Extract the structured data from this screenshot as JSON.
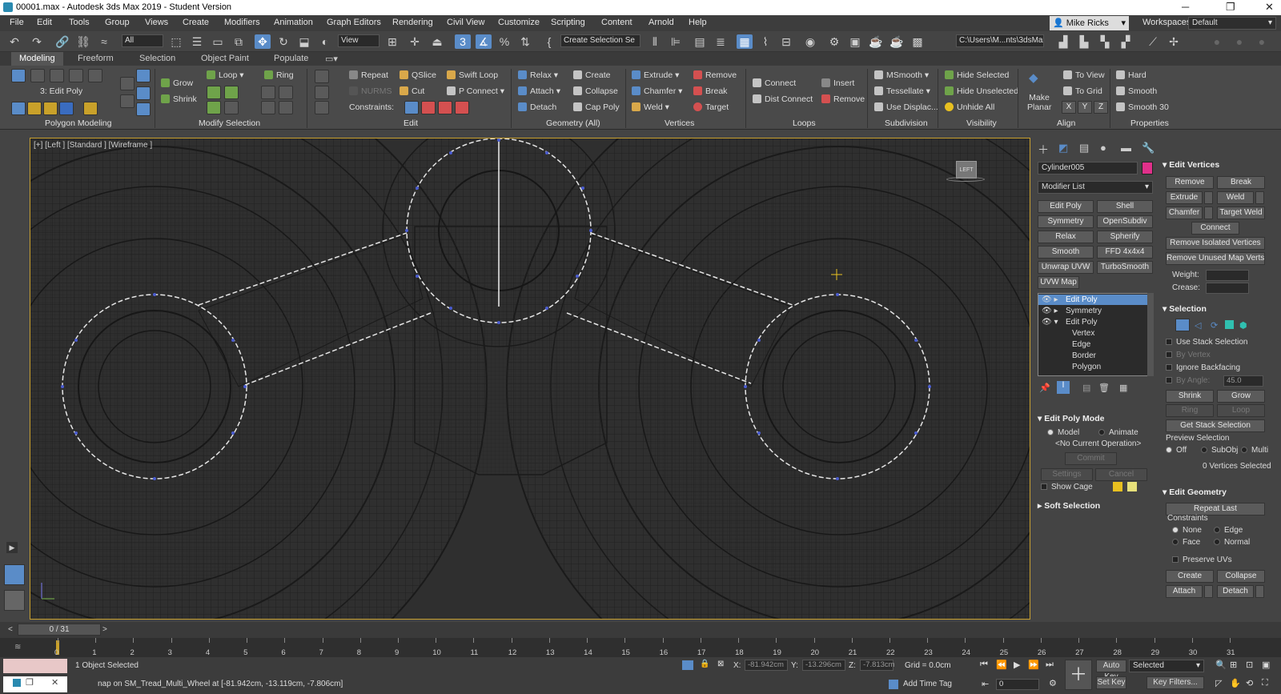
{
  "window": {
    "title": "00001.max - Autodesk 3ds Max 2019 - Student Version"
  },
  "menu": [
    "File",
    "Edit",
    "Tools",
    "Group",
    "Views",
    "Create",
    "Modifiers",
    "Animation",
    "Graph Editors",
    "Rendering",
    "Civil View",
    "Customize",
    "Scripting",
    "Content",
    "Arnold",
    "Help"
  ],
  "user": {
    "name": "Mike Ricks",
    "workspaces_label": "Workspaces:",
    "workspace": "Default"
  },
  "toolbar": {
    "filter": "All",
    "refcoord": "View",
    "selset": "Create Selection Se",
    "path": "C:\\Users\\M...nts\\3dsMax"
  },
  "ribbon_tabs": [
    "Modeling",
    "Freeform",
    "Selection",
    "Object Paint",
    "Populate"
  ],
  "ribbon": {
    "stack_label": "3: Edit Poly",
    "grow": "Grow",
    "shrink": "Shrink",
    "loop": "Loop",
    "ring": "Ring",
    "repeat": "Repeat",
    "nurms": "NURMS",
    "constraints": "Constraints:",
    "qslice": "QSlice",
    "cut": "Cut",
    "swift_loop": "Swift Loop",
    "p_connect": "P Connect",
    "relax": "Relax",
    "attach": "Attach",
    "detach": "Detach",
    "create": "Create",
    "collapse": "Collapse",
    "cap_poly": "Cap Poly",
    "extrude": "Extrude",
    "chamfer": "Chamfer",
    "weld": "Weld",
    "remove": "Remove",
    "break": "Break",
    "target": "Target",
    "connect": "Connect",
    "dist_connect": "Dist Connect",
    "insert": "Insert",
    "remove2": "Remove",
    "msmooth": "MSmooth",
    "tessellate": "Tessellate",
    "use_displac": "Use Displac...",
    "hide_selected": "Hide Selected",
    "hide_unselected": "Hide Unselected",
    "unhide_all": "Unhide All",
    "make_planar": "Make Planar",
    "to_view": "To View",
    "to_grid": "To Grid",
    "x": "X",
    "y": "Y",
    "z": "Z",
    "hard": "Hard",
    "smooth": "Smooth",
    "smooth30": "Smooth 30",
    "panels": [
      "Polygon Modeling",
      "Modify Selection",
      "Edit",
      "Geometry (All)",
      "Vertices",
      "Loops",
      "Subdivision",
      "Visibility",
      "Align",
      "Properties"
    ]
  },
  "viewport": {
    "label": "[+] [Left ] [Standard ] [Wireframe ]",
    "cube_label": "LEFT"
  },
  "cmd": {
    "object_name": "Cylinder005",
    "modifier_list": "Modifier List",
    "mod_buttons": [
      "Edit Poly",
      "Shell",
      "Symmetry",
      "OpenSubdiv",
      "Relax",
      "Spherify",
      "Smooth",
      "FFD 4x4x4",
      "Unwrap UVW",
      "TurboSmooth",
      "UVW Map"
    ],
    "stack": [
      "Edit Poly",
      "Symmetry",
      "Edit Poly",
      "Vertex",
      "Edge",
      "Border",
      "Polygon"
    ],
    "edit_poly_mode": "Edit Poly Mode",
    "model": "Model",
    "animate": "Animate",
    "no_op": "<No Current Operation>",
    "commit": "Commit",
    "settings": "Settings",
    "cancel": "Cancel",
    "show_cage": "Show Cage",
    "soft_selection": "Soft Selection",
    "edit_vertices": "Edit Vertices",
    "remove": "Remove",
    "break": "Break",
    "extrude": "Extrude",
    "weld": "Weld",
    "chamfer": "Chamfer",
    "target_weld": "Target Weld",
    "connect": "Connect",
    "remove_isolated": "Remove Isolated Vertices",
    "remove_unused": "Remove Unused Map Verts",
    "weight": "Weight:",
    "crease": "Crease:",
    "selection": "Selection",
    "use_stack": "Use Stack Selection",
    "by_vertex": "By Vertex",
    "ignore_backfacing": "Ignore Backfacing",
    "by_angle": "By Angle:",
    "angle_val": "45.0",
    "shrink": "Shrink",
    "grow": "Grow",
    "ring": "Ring",
    "loop": "Loop",
    "get_stack": "Get Stack Selection",
    "preview_selection": "Preview Selection",
    "off": "Off",
    "subobj": "SubObj",
    "multi": "Multi",
    "verts_selected": "0 Vertices Selected",
    "edit_geometry": "Edit Geometry",
    "repeat_last": "Repeat Last",
    "constraints": "Constraints",
    "none": "None",
    "edge": "Edge",
    "face": "Face",
    "normal": "Normal",
    "preserve_uvs": "Preserve UVs",
    "create": "Create",
    "collapse": "Collapse",
    "attach": "Attach",
    "detach": "Detach"
  },
  "timeline": {
    "frame": "0 / 31",
    "ticks": [
      "0",
      "1",
      "2",
      "3",
      "4",
      "5",
      "6",
      "7",
      "8",
      "9",
      "10",
      "11",
      "12",
      "13",
      "14",
      "15",
      "16",
      "17",
      "18",
      "19",
      "20",
      "21",
      "22",
      "23",
      "24",
      "25",
      "26",
      "27",
      "28",
      "29",
      "30",
      "31"
    ]
  },
  "status": {
    "objects_selected": "1 Object Selected",
    "prompt": "nap on SM_Tread_Multi_Wheel at [-81.942cm, -13.119cm, -7.806cm]",
    "x_label": "X:",
    "x": "-81.942cm",
    "y_label": "Y:",
    "y": "-13.296cm",
    "z_label": "Z:",
    "z": "-7.813cm",
    "grid": "Grid = 0.0cm",
    "add_time_tag": "Add Time Tag",
    "auto_key": "Auto Key",
    "selected": "Selected",
    "set_key": "Set Key",
    "key_filters": "Key Filters...",
    "frame": "0"
  },
  "colors": {
    "selection_blue": "#5a8cc8",
    "object_color": "#e0308a",
    "viewport_border": "#c8a030",
    "cage_yellow": "#e8c020",
    "cage_light": "#e6e07a"
  }
}
